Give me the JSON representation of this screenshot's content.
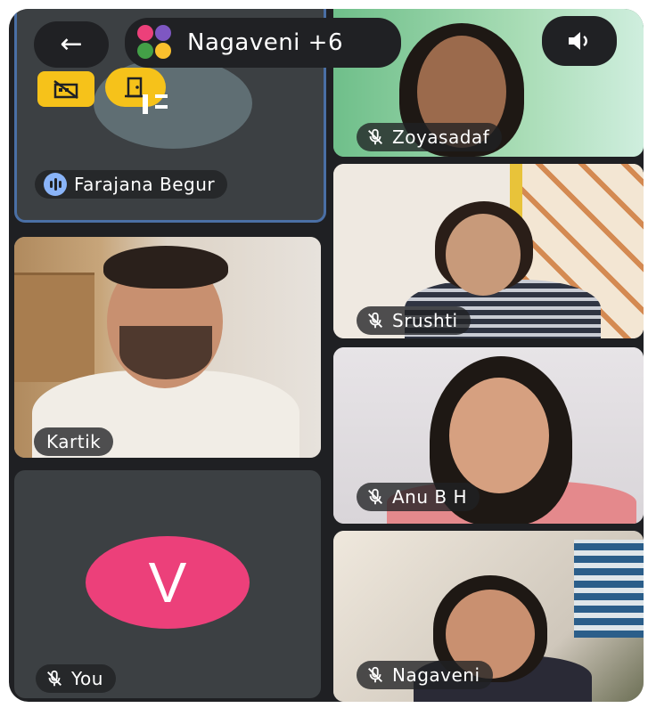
{
  "topbar": {
    "back_label": "←",
    "meeting_title": "Nagaveni +6",
    "audio_icon": "speaker-icon"
  },
  "participants": [
    {
      "name": "Farajana Begur",
      "state": "speaking"
    },
    {
      "name": "Zoyasadaf",
      "state": "muted"
    },
    {
      "name": "Srushti",
      "state": "muted"
    },
    {
      "name": "Kartik",
      "state": "unmuted"
    },
    {
      "name": "Anu B H",
      "state": "muted"
    },
    {
      "name": "You",
      "state": "muted",
      "avatar_letter": "V"
    },
    {
      "name": "Nagaveni",
      "state": "muted"
    }
  ],
  "colors": {
    "background": "#1f2023",
    "tile": "#3c4043",
    "speaking_border": "#8ab4f8",
    "avatar_you": "#ec407a",
    "badge_yellow": "#f6c21a"
  }
}
